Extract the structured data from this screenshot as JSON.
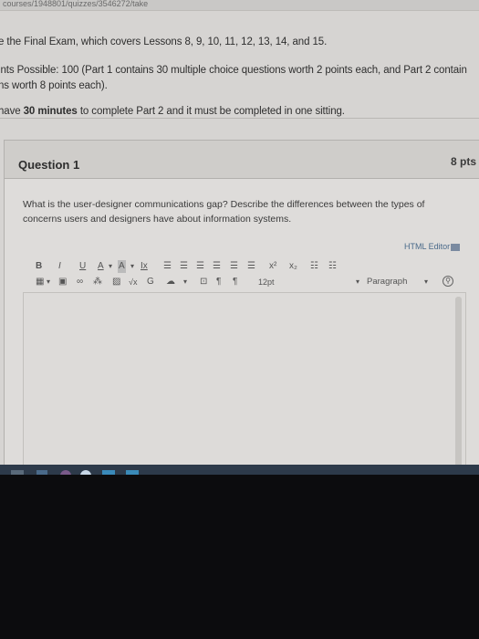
{
  "browser": {
    "url": "courses/1948801/quizzes/3546272/take"
  },
  "intro": {
    "line1": "e the Final Exam, which covers Lessons 8, 9, 10, 11, 12, 13, 14, and 15.",
    "line2": "ints Possible: 100 (Part 1 contains 30 multiple choice questions worth 2 points each, and Part 2 contain",
    "line3": "ns worth 8 points each).",
    "line4_pre": "have ",
    "line4_bold": "30 minutes",
    "line4_post": " to complete Part 2 and it must be completed in one sitting."
  },
  "question": {
    "title": "Question 1",
    "points": "8 pts",
    "text": "What is the user-designer communications gap? Describe the differences between the types of concerns users and designers have about information systems."
  },
  "editor": {
    "html_editor_label": "HTML Editor",
    "toolbar_row1": [
      "B",
      "I",
      "U",
      "A",
      "A",
      "Ix",
      "x²",
      "x₂"
    ],
    "font_size": "12pt",
    "paragraph_select": "Paragraph"
  },
  "colors": {
    "screen_bg": "#d6d4d2",
    "card_header": "#cfcdca",
    "taskbar": "#2d3a4a"
  }
}
